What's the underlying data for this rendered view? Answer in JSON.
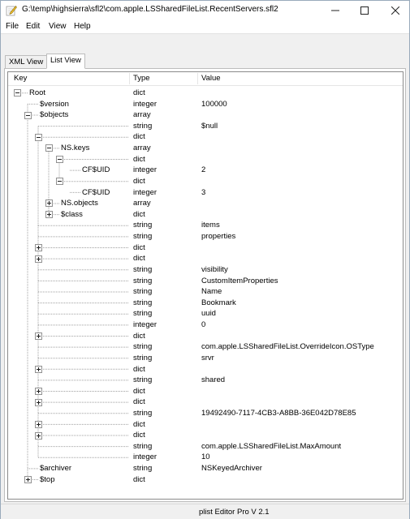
{
  "window": {
    "title": "G:\\temp\\highsierra\\sfl2\\com.apple.LSSharedFileList.RecentServers.sfl2",
    "minimize_icon": "minimize-icon",
    "maximize_icon": "maximize-icon",
    "close_icon": "close-icon"
  },
  "menu": [
    "File",
    "Edit",
    "View",
    "Help"
  ],
  "tabs": [
    {
      "label": "XML View",
      "active": false
    },
    {
      "label": "List View",
      "active": true
    }
  ],
  "columns": {
    "key": "Key",
    "type": "Type",
    "value": "Value"
  },
  "rows": [
    {
      "depth": 0,
      "exp": "minus",
      "key": "Root",
      "type": "dict",
      "value": ""
    },
    {
      "depth": 1,
      "exp": "none",
      "key": "$version",
      "type": "integer",
      "value": "100000"
    },
    {
      "depth": 1,
      "exp": "minus",
      "key": "$objects",
      "type": "array",
      "value": ""
    },
    {
      "depth": 2,
      "exp": "none",
      "key": "",
      "type": "string",
      "value": "$null"
    },
    {
      "depth": 2,
      "exp": "minus",
      "key": "",
      "type": "dict",
      "value": ""
    },
    {
      "depth": 3,
      "exp": "minus",
      "key": "NS.keys",
      "type": "array",
      "value": ""
    },
    {
      "depth": 4,
      "exp": "minus",
      "key": "",
      "type": "dict",
      "value": ""
    },
    {
      "depth": 5,
      "exp": "none",
      "key": "CF$UID",
      "type": "integer",
      "value": "2"
    },
    {
      "depth": 4,
      "exp": "minus",
      "key": "",
      "type": "dict",
      "value": ""
    },
    {
      "depth": 5,
      "exp": "none",
      "key": "CF$UID",
      "type": "integer",
      "value": "3"
    },
    {
      "depth": 3,
      "exp": "plus",
      "key": "NS.objects",
      "type": "array",
      "value": ""
    },
    {
      "depth": 3,
      "exp": "plus",
      "key": "$class",
      "type": "dict",
      "value": ""
    },
    {
      "depth": 2,
      "exp": "none",
      "key": "",
      "type": "string",
      "value": "items"
    },
    {
      "depth": 2,
      "exp": "none",
      "key": "",
      "type": "string",
      "value": "properties"
    },
    {
      "depth": 2,
      "exp": "plus",
      "key": "",
      "type": "dict",
      "value": ""
    },
    {
      "depth": 2,
      "exp": "plus",
      "key": "",
      "type": "dict",
      "value": ""
    },
    {
      "depth": 2,
      "exp": "none",
      "key": "",
      "type": "string",
      "value": "visibility"
    },
    {
      "depth": 2,
      "exp": "none",
      "key": "",
      "type": "string",
      "value": "CustomItemProperties"
    },
    {
      "depth": 2,
      "exp": "none",
      "key": "",
      "type": "string",
      "value": "Name"
    },
    {
      "depth": 2,
      "exp": "none",
      "key": "",
      "type": "string",
      "value": "Bookmark"
    },
    {
      "depth": 2,
      "exp": "none",
      "key": "",
      "type": "string",
      "value": "uuid"
    },
    {
      "depth": 2,
      "exp": "none",
      "key": "",
      "type": "integer",
      "value": "0"
    },
    {
      "depth": 2,
      "exp": "plus",
      "key": "",
      "type": "dict",
      "value": ""
    },
    {
      "depth": 2,
      "exp": "none",
      "key": "",
      "type": "string",
      "value": "com.apple.LSSharedFileList.OverrideIcon.OSType"
    },
    {
      "depth": 2,
      "exp": "none",
      "key": "",
      "type": "string",
      "value": "srvr"
    },
    {
      "depth": 2,
      "exp": "plus",
      "key": "",
      "type": "dict",
      "value": ""
    },
    {
      "depth": 2,
      "exp": "none",
      "key": "",
      "type": "string",
      "value": "shared"
    },
    {
      "depth": 2,
      "exp": "plus",
      "key": "",
      "type": "dict",
      "value": ""
    },
    {
      "depth": 2,
      "exp": "plus",
      "key": "",
      "type": "dict",
      "value": ""
    },
    {
      "depth": 2,
      "exp": "none",
      "key": "",
      "type": "string",
      "value": "19492490-7117-4CB3-A8BB-36E042D78E85"
    },
    {
      "depth": 2,
      "exp": "plus",
      "key": "",
      "type": "dict",
      "value": ""
    },
    {
      "depth": 2,
      "exp": "plus",
      "key": "",
      "type": "dict",
      "value": ""
    },
    {
      "depth": 2,
      "exp": "none",
      "key": "",
      "type": "string",
      "value": "com.apple.LSSharedFileList.MaxAmount"
    },
    {
      "depth": 2,
      "exp": "none",
      "key": "",
      "type": "integer",
      "value": "10"
    },
    {
      "depth": 1,
      "exp": "none",
      "key": "$archiver",
      "type": "string",
      "value": "NSKeyedArchiver"
    },
    {
      "depth": 1,
      "exp": "plus",
      "key": "$top",
      "type": "dict",
      "value": ""
    }
  ],
  "status": "plist Editor Pro V 2.1",
  "colors": {
    "tree_line": "#a0a0a0",
    "expander_border": "#919191",
    "title_icon": "#f2c230"
  }
}
